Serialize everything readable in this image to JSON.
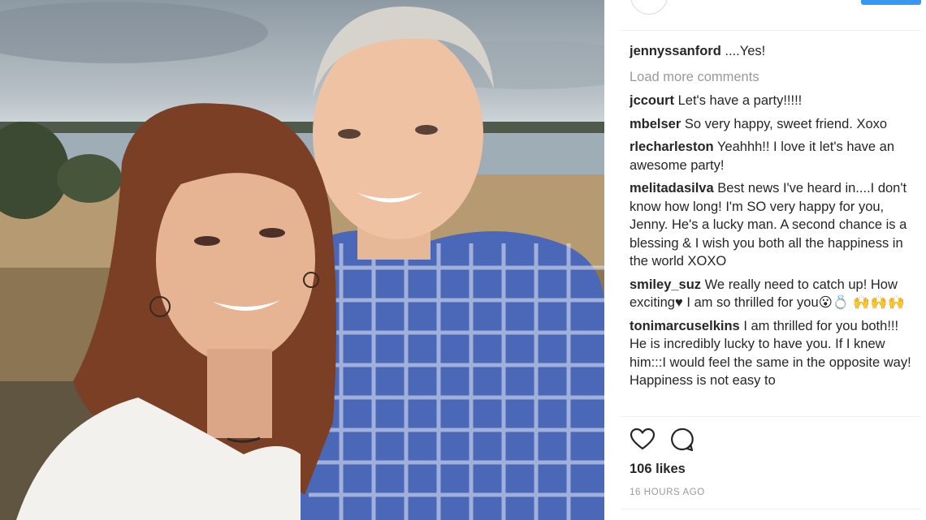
{
  "post": {
    "caption": {
      "user": "jennyssanford",
      "text": "....Yes!"
    },
    "load_more": "Load more comments",
    "comments": [
      {
        "user": "jccourt",
        "text": "Let's have a party!!!!!"
      },
      {
        "user": "mbelser",
        "text": "So very happy, sweet friend. Xoxo"
      },
      {
        "user": "rlecharleston",
        "text": "Yeahhh!! I love it let's have an awesome party!"
      },
      {
        "user": "melitadasilva",
        "text": "Best news I've heard in....I don't know how long! I'm SO very happy for you, Jenny. He's a lucky man. A second chance is a blessing & I wish you both all the happiness in the world XOXO"
      },
      {
        "user": "smiley_suz",
        "text": "We really need to catch up! How exciting♥ I am so thrilled for you😮💍",
        "extra": "🙌🙌🙌"
      },
      {
        "user": "tonimarcuselkins",
        "text": "I am thrilled for you both!!! He is incredibly lucky to have you. If I knew him:::I would feel the same in the opposite way! Happiness is not easy to"
      }
    ],
    "likes": "106 likes",
    "timestamp": "16 HOURS AGO"
  },
  "icons": {
    "like": "heart-icon",
    "comment": "comment-icon"
  },
  "colors": {
    "primary_text": "#262626",
    "secondary_text": "#999999",
    "divider": "#efefef",
    "follow_blue": "#3897f0"
  }
}
